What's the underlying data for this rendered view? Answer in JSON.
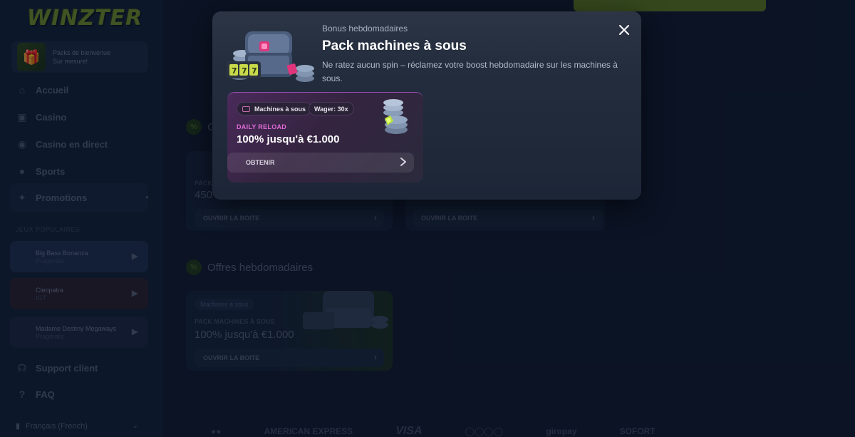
{
  "brand": {
    "logo": "WINZTER"
  },
  "sidebar": {
    "welcome": {
      "line1": "Packs de bienvenue",
      "line2": "Sur mesure!"
    },
    "nav": [
      {
        "label": "Accueil",
        "icon": "home-icon"
      },
      {
        "label": "Casino",
        "icon": "cards-icon"
      },
      {
        "label": "Casino en direct",
        "icon": "live-icon"
      },
      {
        "label": "Sports",
        "icon": "ball-icon"
      },
      {
        "label": "Promotions",
        "icon": "gift-icon"
      }
    ],
    "popular_label": "JEUX POPULAIRES",
    "games": [
      {
        "name": "Big Bass Bonanza",
        "provider": "Pragmatic"
      },
      {
        "name": "Cleopatra",
        "provider": "IGT"
      },
      {
        "name": "Madame Destiny Megaways",
        "provider": "Pragmatic"
      }
    ],
    "support": "Support client",
    "faq": "FAQ",
    "language": "Français (French)"
  },
  "main": {
    "section1_title": "C",
    "card1": {
      "kicker": "PACK",
      "amount": "450",
      "button": "OUVRIR LA BOITE"
    },
    "card2": {
      "button": "OUVRIR LA BOITE"
    },
    "section2_title": "Offres hebdomadaires",
    "card3": {
      "tag": "Machines à sous",
      "kicker": "PACK MACHINES À SOUS",
      "amount": "100% jusqu'à €1.000",
      "button": "OUVRIR LA BOITE"
    },
    "payments": [
      "AMERICAN EXPRESS",
      "VISA",
      "giropay",
      "SOFORT"
    ]
  },
  "modal": {
    "subtitle": "Bonus hebdomadaires",
    "title": "Pack machines à sous",
    "description": "Ne ratez aucun spin – réclamez votre boost hebdomadaire sur les machines à sous.",
    "bonus": {
      "tag_category": "Machines à sous",
      "tag_wager": "Wager: 30x",
      "kicker": "DAILY RELOAD",
      "amount": "100% jusqu'à €1.000",
      "button": "OBTENIR"
    }
  },
  "colors": {
    "background": "#0f1a2e",
    "accent_green": "#5c7a22",
    "accent_pink": "#e06bd8",
    "modal_bg": "#232d3d"
  }
}
